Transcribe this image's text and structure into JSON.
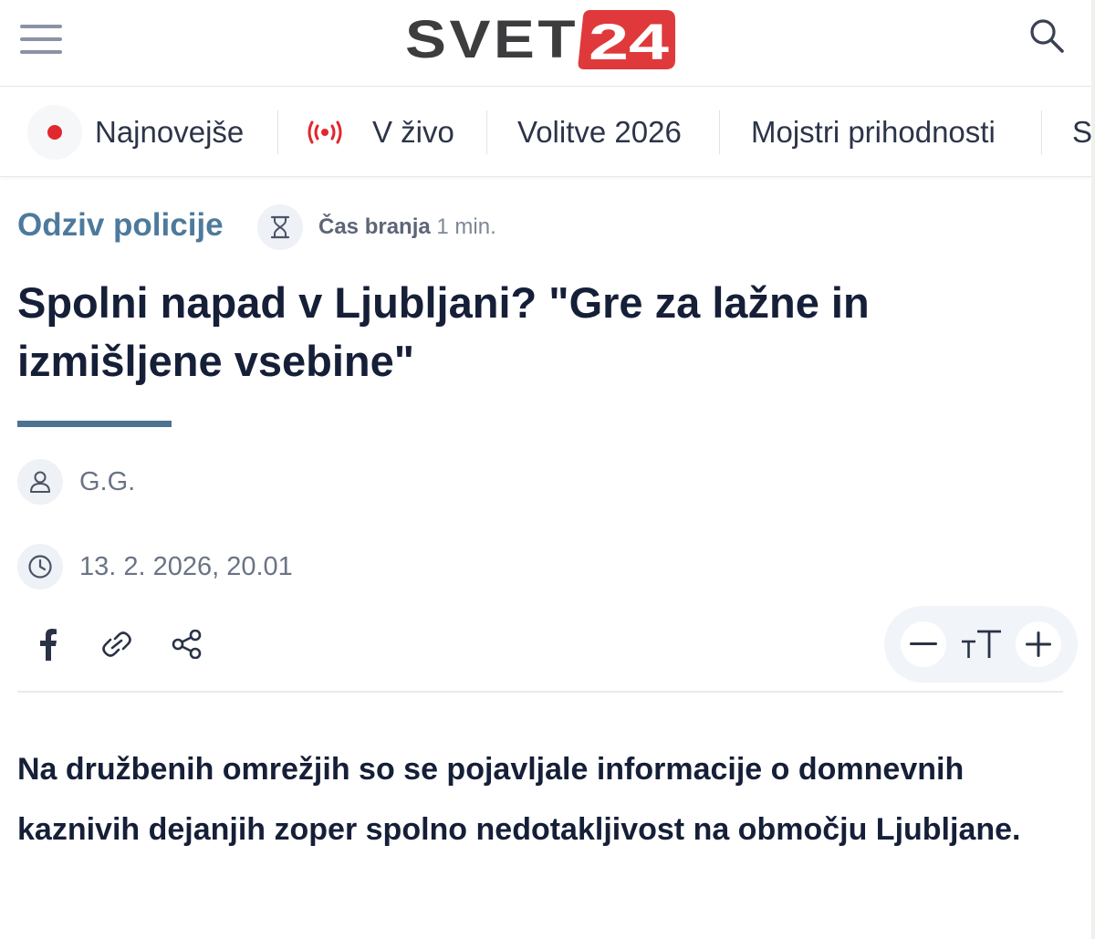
{
  "header": {
    "logo_text": "SVET",
    "logo_number": "24"
  },
  "nav": {
    "items": [
      {
        "label": "Najnovejše",
        "icon": "live-dot-icon"
      },
      {
        "label": "V živo",
        "icon": "broadcast-icon"
      },
      {
        "label": "Volitve 2026"
      },
      {
        "label": "Mojstri prihodnosti"
      },
      {
        "label": "S"
      }
    ]
  },
  "article": {
    "category": "Odziv policije",
    "read_time_label": "Čas branja",
    "read_time_value": "1 min.",
    "title": "Spolni napad v Ljubljani? \"Gre za lažne in izmišljene vsebine\"",
    "author": "G.G.",
    "date": "13. 2. 2026, 20.01",
    "lead": "Na družbenih omrežjih so se pojavljale informacije o domnevnih kaznivih dejanjih zoper spolno nedotakljivost na območju Ljubljane."
  },
  "colors": {
    "accent": "#4d7a9c",
    "live_red": "#e0282e",
    "logo_badge": "#e0393b",
    "logo_text": "#3d3d3f"
  }
}
